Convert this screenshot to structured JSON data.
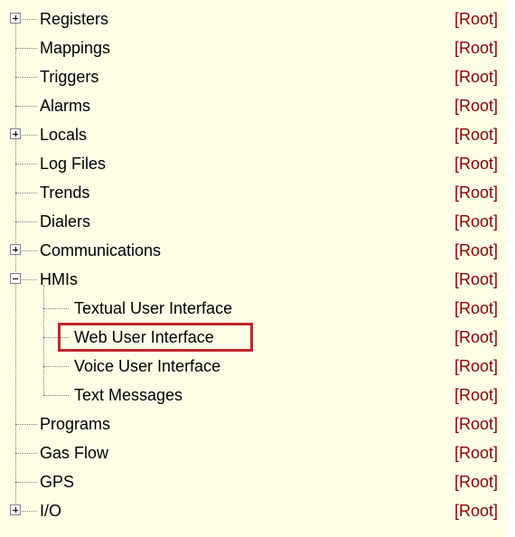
{
  "tree": {
    "items": [
      {
        "label": "Registers",
        "status": "[Root]",
        "expander": "plus"
      },
      {
        "label": "Mappings",
        "status": "[Root]",
        "expander": "none"
      },
      {
        "label": "Triggers",
        "status": "[Root]",
        "expander": "none"
      },
      {
        "label": "Alarms",
        "status": "[Root]",
        "expander": "none"
      },
      {
        "label": "Locals",
        "status": "[Root]",
        "expander": "plus"
      },
      {
        "label": "Log Files",
        "status": "[Root]",
        "expander": "none"
      },
      {
        "label": "Trends",
        "status": "[Root]",
        "expander": "none"
      },
      {
        "label": "Dialers",
        "status": "[Root]",
        "expander": "none"
      },
      {
        "label": "Communications",
        "status": "[Root]",
        "expander": "plus"
      },
      {
        "label": "HMIs",
        "status": "[Root]",
        "expander": "minus"
      },
      {
        "label": "Textual User Interface",
        "status": "[Root]",
        "expander": "none",
        "child": true
      },
      {
        "label": "Web User Interface",
        "status": "[Root]",
        "expander": "none",
        "child": true,
        "highlighted": true
      },
      {
        "label": "Voice User Interface",
        "status": "[Root]",
        "expander": "none",
        "child": true
      },
      {
        "label": "Text Messages",
        "status": "[Root]",
        "expander": "none",
        "child": true
      },
      {
        "label": "Programs",
        "status": "[Root]",
        "expander": "none"
      },
      {
        "label": "Gas Flow",
        "status": "[Root]",
        "expander": "none"
      },
      {
        "label": "GPS",
        "status": "[Root]",
        "expander": "none"
      },
      {
        "label": "I/O",
        "status": "[Root]",
        "expander": "plus"
      }
    ]
  },
  "colors": {
    "background": "#fefee7",
    "status_text": "#8b0000",
    "highlight_border": "#c0282d"
  }
}
